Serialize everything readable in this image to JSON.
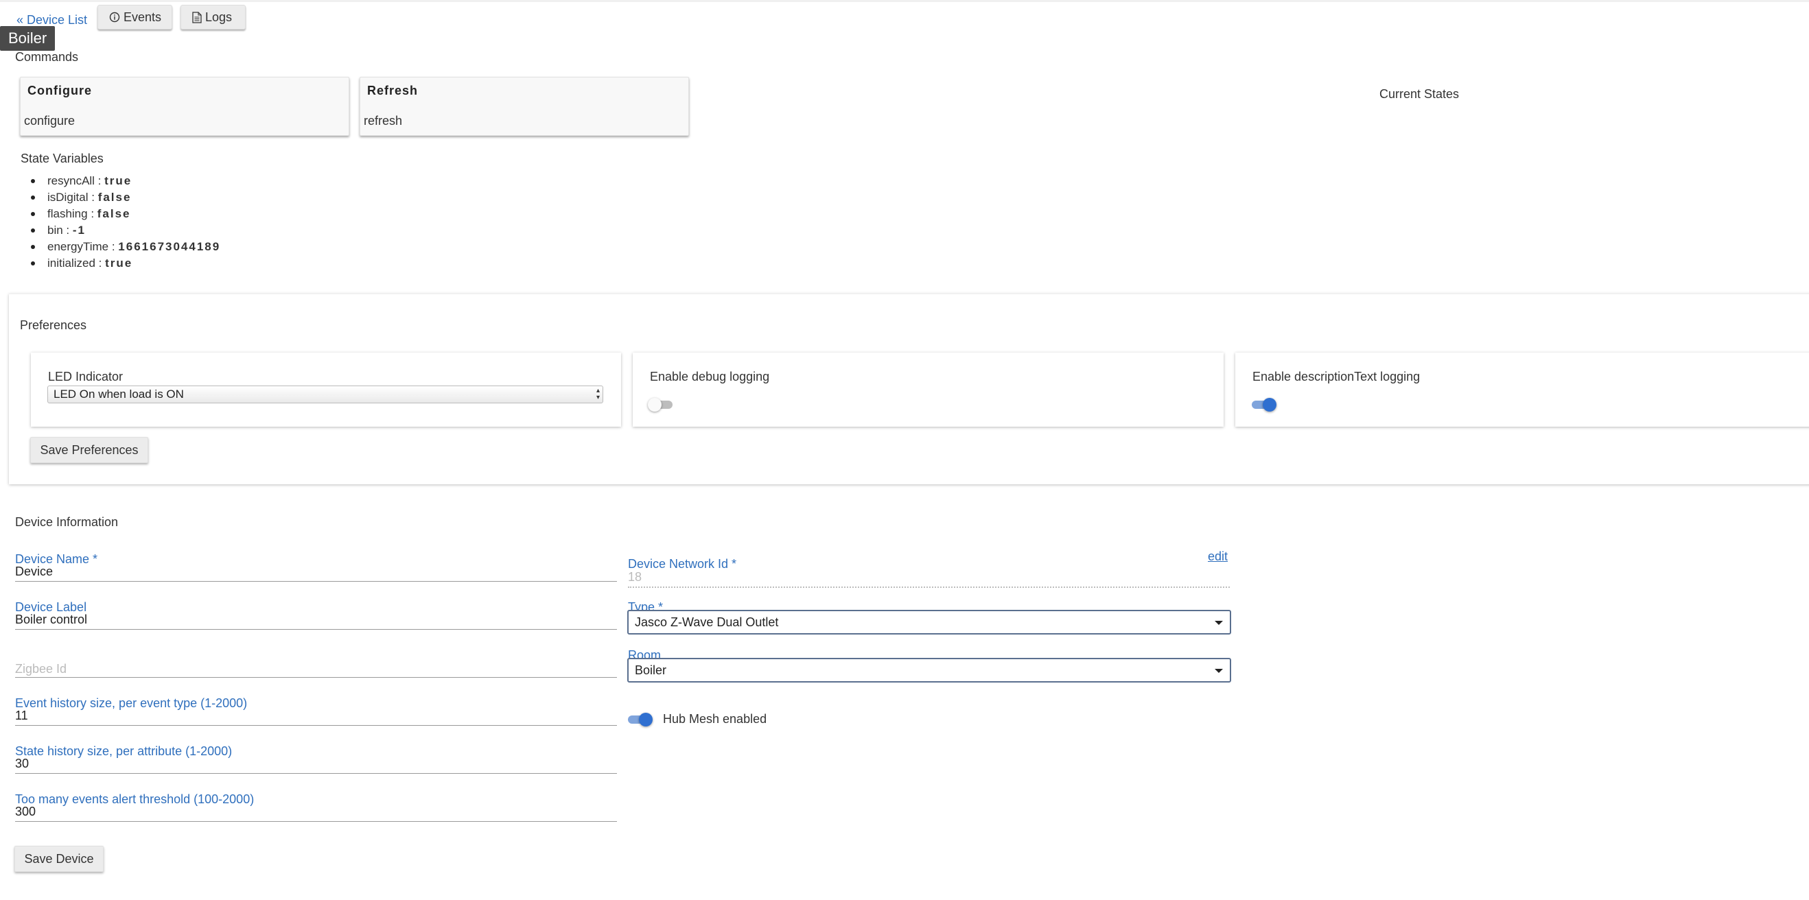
{
  "nav": {
    "back_link": "« Device List",
    "events_button": "Events",
    "logs_button": "Logs",
    "tooltip": "Boiler"
  },
  "commands": {
    "heading": "Commands",
    "items": [
      {
        "title": "Configure",
        "value": "configure"
      },
      {
        "title": "Refresh",
        "value": "refresh"
      }
    ]
  },
  "current_states": {
    "heading": "Current States"
  },
  "state_variables": {
    "heading": "State Variables",
    "items": [
      {
        "name": "resyncAll : ",
        "value": "true"
      },
      {
        "name": "isDigital : ",
        "value": "false"
      },
      {
        "name": "flashing : ",
        "value": "false"
      },
      {
        "name": "bin : ",
        "value": "-1"
      },
      {
        "name": "energyTime : ",
        "value": "1661673044189"
      },
      {
        "name": "initialized : ",
        "value": "true"
      }
    ]
  },
  "preferences": {
    "heading": "Preferences",
    "led_indicator": {
      "label": "LED Indicator",
      "selected": "LED On when load is ON"
    },
    "debug_logging": {
      "label": "Enable debug logging",
      "enabled": false
    },
    "description_logging": {
      "label": "Enable descriptionText logging",
      "enabled": true
    },
    "save_button": "Save Preferences"
  },
  "device_info": {
    "heading": "Device Information",
    "device_name": {
      "label": "Device Name *",
      "value": "Device"
    },
    "device_label": {
      "label": "Device Label",
      "value": "Boiler control"
    },
    "zigbee_id": {
      "placeholder": "Zigbee Id"
    },
    "event_history": {
      "label": "Event history size, per event type (1-2000)",
      "value": "11"
    },
    "state_history": {
      "label": "State history size, per attribute (1-2000)",
      "value": "30"
    },
    "alert_threshold": {
      "label": "Too many events alert threshold (100-2000)",
      "value": "300"
    },
    "network_id": {
      "label": "Device Network Id *",
      "value": "18",
      "edit_link": "edit"
    },
    "type": {
      "label": "Type *",
      "value": "Jasco Z-Wave Dual Outlet"
    },
    "room": {
      "label": "Room",
      "value": "Boiler"
    },
    "hub_mesh": {
      "label": "Hub Mesh enabled",
      "enabled": true
    },
    "save_button": "Save Device"
  },
  "colors": {
    "link": "#2f6fbd",
    "toggle_on": "#2f6fd0",
    "toggle_track_on": "#7fa4dc",
    "toggle_off": "#bdbdbd",
    "tooltip_bg": "#4a4a4a"
  }
}
